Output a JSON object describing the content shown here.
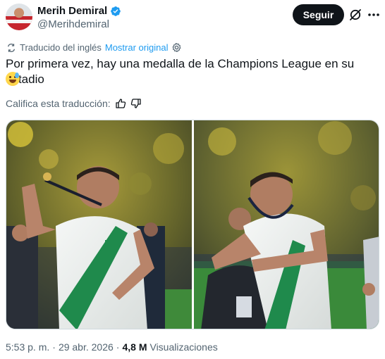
{
  "author": {
    "display_name": "Merih Demiral",
    "handle": "@Merihdemiral",
    "verified": true
  },
  "header": {
    "follow_label": "Seguir",
    "icons": [
      "grok-icon",
      "more-icon"
    ]
  },
  "translation": {
    "label": "Traducido del inglés",
    "show_original": "Mostrar original",
    "rate_label": "Califica esta traducción:"
  },
  "tweet": {
    "text": "Por primera vez, hay una medalla de la Champions League en su estadio",
    "emoji": "😅"
  },
  "media": {
    "count": 2
  },
  "meta": {
    "time": "5:53 p. m.",
    "separator": "·",
    "date": "29 abr. 2026",
    "views_count": "4,8 M",
    "views_label": "Visualizaciones"
  },
  "colors": {
    "text": "#0f1419",
    "secondary": "#536471",
    "link": "#1d9bf0",
    "button": "#0f1419",
    "verified": "#1d9bf0"
  }
}
